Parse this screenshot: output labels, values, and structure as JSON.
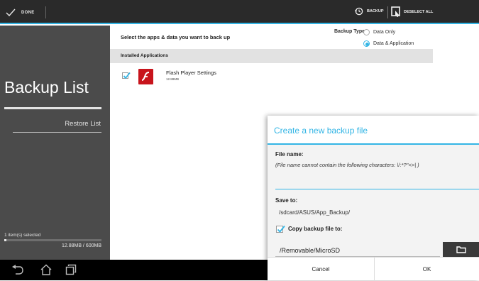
{
  "topbar": {
    "done_label": "DONE",
    "backup_label": "BACKUP",
    "deselect_label": "DESELECT ALL",
    "accent_color": "#33b5e5"
  },
  "sidebar": {
    "title": "Backup List",
    "restore_label": "Restore List",
    "selected_count": "1 item(s) selected",
    "size_label": "12.88MB / 600MB",
    "usage_fraction": 0.0215
  },
  "main": {
    "prompt": "Select the apps & data you want to back up",
    "backup_type_label": "Backup Type:",
    "options": [
      {
        "label": "Data Only",
        "selected": false
      },
      {
        "label": "Data & Application",
        "selected": true
      }
    ],
    "section_header": "Installed Applications",
    "apps": [
      {
        "name": "Flash Player Settings",
        "size": "12.88MB",
        "checked": true
      }
    ]
  },
  "dialog": {
    "title": "Create a new backup file",
    "file_name_label": "File name:",
    "file_name_hint": "(File name cannot contain the following characters: \\/:*?\"<>| )",
    "file_name_value": "",
    "save_to_label": "Save to:",
    "save_path": "/sdcard/ASUS/App_Backup/",
    "copy_label": "Copy backup file to:",
    "copy_checked": true,
    "copy_destination": "/Removable/MicroSD",
    "cancel_label": "Cancel",
    "ok_label": "OK"
  },
  "navbar": {
    "icons": [
      "back-icon",
      "home-icon",
      "recent-apps-icon"
    ]
  }
}
